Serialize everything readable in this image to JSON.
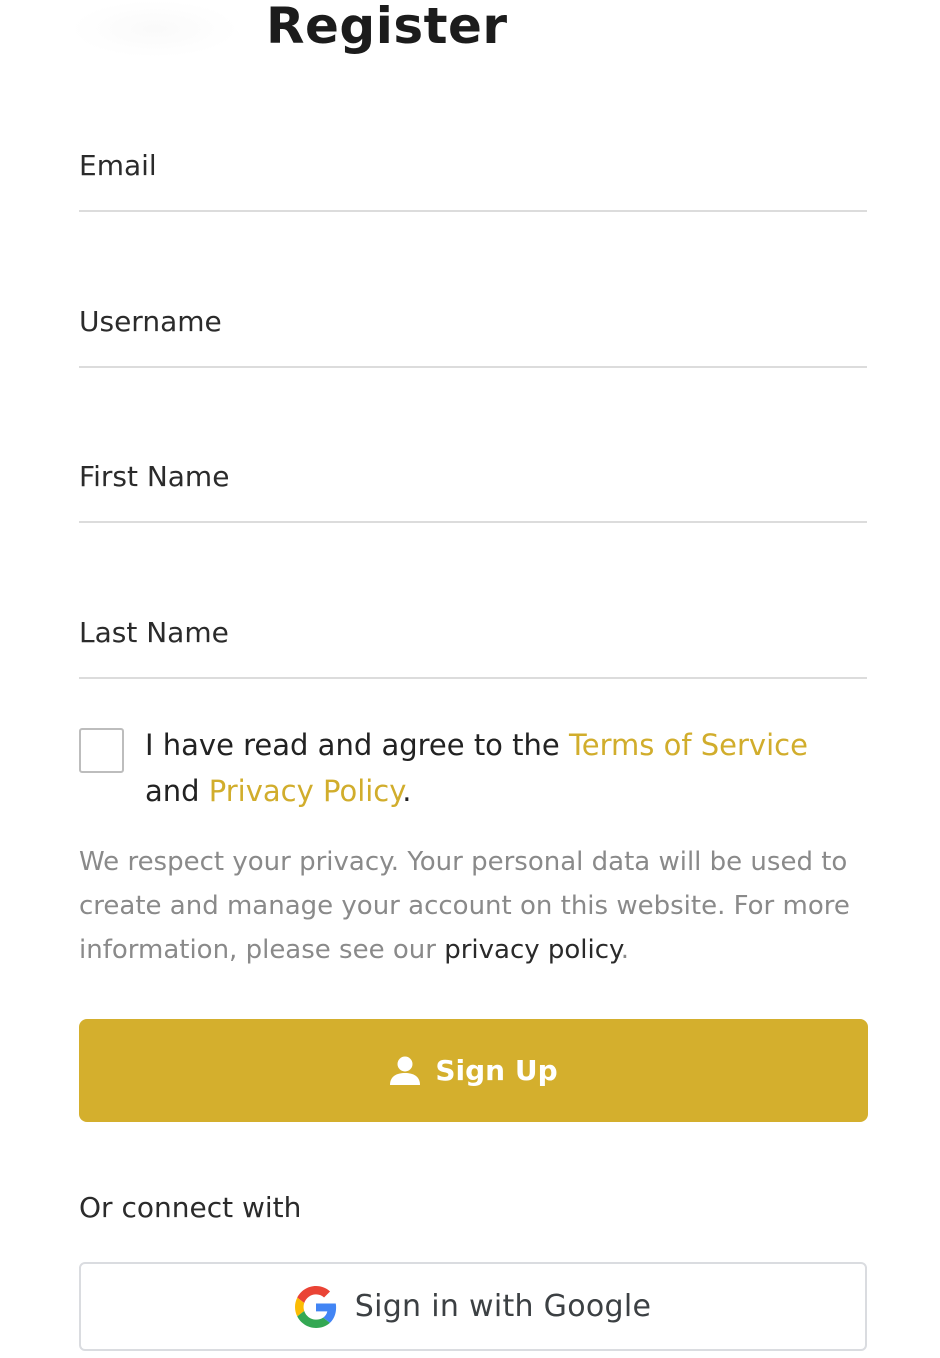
{
  "title": "Register",
  "fields": {
    "email": {
      "placeholder": "Email",
      "value": ""
    },
    "username": {
      "placeholder": "Username",
      "value": ""
    },
    "first_name": {
      "placeholder": "First Name",
      "value": ""
    },
    "last_name": {
      "placeholder": "Last Name",
      "value": ""
    }
  },
  "agreement": {
    "checked": false,
    "prefix": "I have read and agree to the ",
    "terms_link": "Terms of Service",
    "middle": " and ",
    "privacy_link": "Privacy Policy",
    "suffix": "."
  },
  "privacy_note": {
    "text": "We respect your privacy. Your personal data will be used to create and manage your account on this website. For more information, please see our ",
    "link": "privacy policy",
    "suffix": "."
  },
  "signup_button": {
    "label": "Sign Up",
    "icon": "user-icon"
  },
  "connect_label": "Or connect with",
  "google_button": {
    "label": "Sign in with Google",
    "icon": "google-icon"
  },
  "colors": {
    "accent": "#d4af2d",
    "link": "#d1ad2c",
    "muted_text": "#8a8a8a"
  }
}
